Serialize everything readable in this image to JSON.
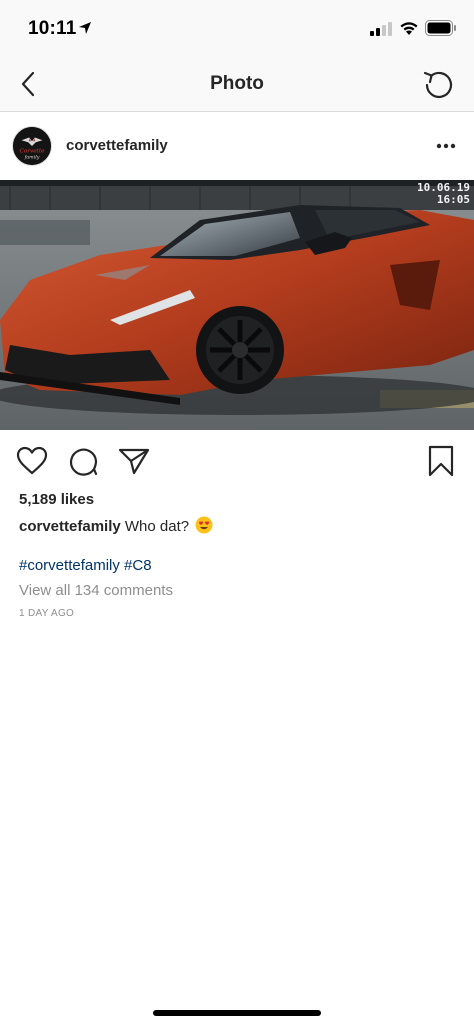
{
  "status_bar": {
    "time": "10:11",
    "icons": [
      "location-arrow-icon",
      "signal-icon",
      "wifi-icon",
      "battery-icon"
    ]
  },
  "nav": {
    "title": "Photo",
    "back_icon": "chevron-left-icon",
    "refresh_icon": "refresh-icon"
  },
  "post": {
    "username": "corvettefamily",
    "avatar_text": "Corvette Family",
    "photo": {
      "timestamp_line1": "10.06.19",
      "timestamp_line2": "16:05"
    },
    "likes": "5,189 likes",
    "caption_user": "corvettefamily",
    "caption_text": "Who dat?",
    "hashtag_1": "#corvettefamily",
    "hashtag_2": "#C8",
    "view_comments": "View all 134 comments",
    "time_ago": "1 DAY AGO"
  },
  "colors": {
    "hashtag": "#003569",
    "secondary_text": "#8e8e8e",
    "primary_text": "#262626",
    "car_body": "#b8401f"
  }
}
